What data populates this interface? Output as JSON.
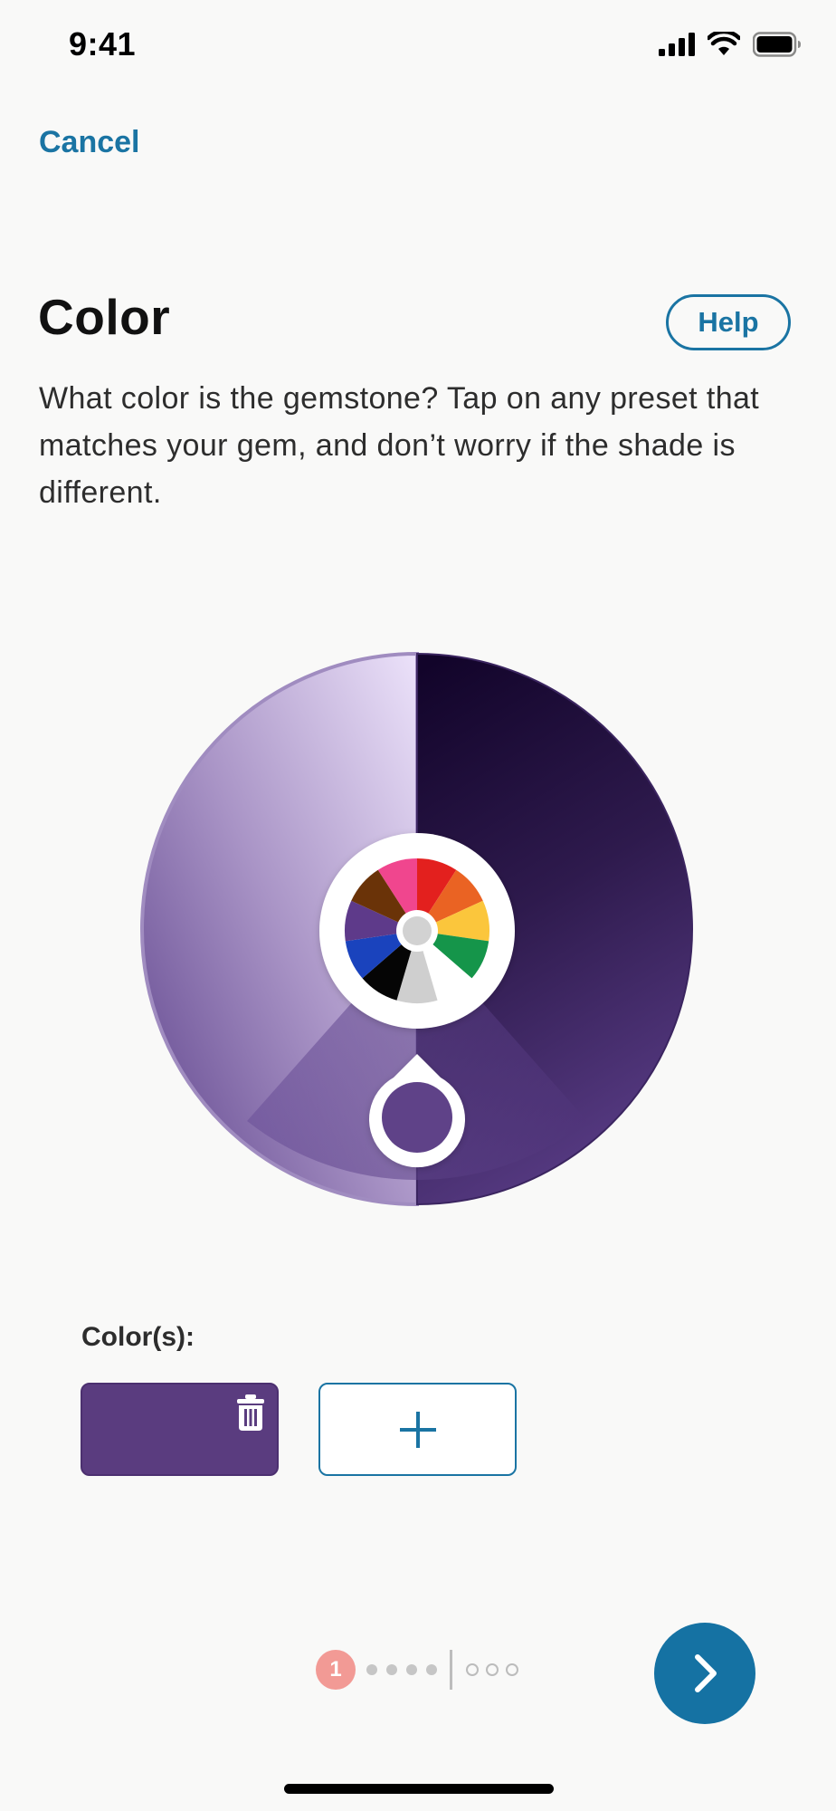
{
  "status_bar": {
    "time": "9:41"
  },
  "nav": {
    "cancel_label": "Cancel"
  },
  "header": {
    "title": "Color",
    "help_label": "Help"
  },
  "description": "What color is the gemstone? Tap on any preset that matches your gem, and don’t worry if the shade is different.",
  "color_wheel": {
    "selected_hue": "purple",
    "light_shade": "#e9dff8",
    "dark_shade": "#15062b",
    "presets": [
      {
        "name": "pink",
        "color": "#f0468e"
      },
      {
        "name": "red",
        "color": "#e3201e"
      },
      {
        "name": "orange",
        "color": "#ea6323"
      },
      {
        "name": "yellow",
        "color": "#fbc63c"
      },
      {
        "name": "green",
        "color": "#15954a"
      },
      {
        "name": "white",
        "color": "#ffffff"
      },
      {
        "name": "gray",
        "color": "#cfcfcf"
      },
      {
        "name": "black",
        "color": "#050505"
      },
      {
        "name": "blue",
        "color": "#1a43bd"
      },
      {
        "name": "purple",
        "color": "#5e3a8a"
      },
      {
        "name": "brown",
        "color": "#6a3308"
      }
    ]
  },
  "colors_section": {
    "label": "Color(s):",
    "selected": [
      {
        "color": "#5a3c7f"
      }
    ],
    "add_icon": "plus-icon",
    "remove_icon": "trash-icon"
  },
  "pager": {
    "current_step": "1",
    "steps_before_divider": 4,
    "steps_after_divider": 3
  },
  "next_icon": "chevron-right-icon",
  "accent_color": "#1a74a3"
}
